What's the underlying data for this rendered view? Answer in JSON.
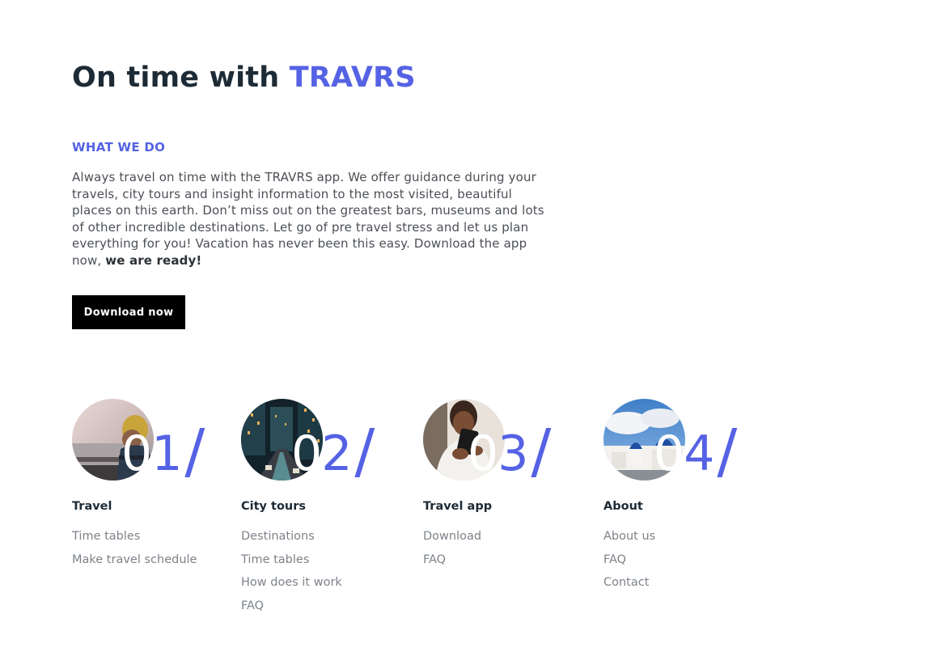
{
  "hero": {
    "title_lead": "On time with ",
    "title_brand": "TRAVRS",
    "eyebrow": "WHAT WE DO",
    "body": "Always travel on time with the TRAVRS app. We offer guidance during your travels, city tours and insight information to the most visited, beautiful places on this earth. Don’t miss out on the greatest bars, museums and lots of other incredible destinations. Let go of pre travel stress and let us plan everything for you! Vacation has never been this easy. Download the app now, ",
    "body_bold": "we are ready!",
    "cta_label": "Download now"
  },
  "colors": {
    "accent": "#5562e4",
    "dark": "#1d2b36",
    "button": "#000000",
    "link": "#7d838a"
  },
  "columns": [
    {
      "number_lead": "0",
      "number_rest": "1",
      "slash": "/",
      "title": "Travel",
      "image": "traveler-at-window-photo",
      "links": [
        "Time tables",
        "Make travel schedule"
      ]
    },
    {
      "number_lead": "0",
      "number_rest": "2",
      "slash": "/",
      "title": "City tours",
      "image": "city-street-night-photo",
      "links": [
        "Destinations",
        "Time tables",
        "How does it work",
        "FAQ"
      ]
    },
    {
      "number_lead": "0",
      "number_rest": "3",
      "slash": "/",
      "title": "Travel app",
      "image": "person-using-phone-photo",
      "links": [
        "Download",
        "FAQ"
      ]
    },
    {
      "number_lead": "0",
      "number_rest": "4",
      "slash": "/",
      "title": "About",
      "image": "santorini-domes-photo",
      "links": [
        "About us",
        "FAQ",
        "Contact"
      ]
    }
  ]
}
